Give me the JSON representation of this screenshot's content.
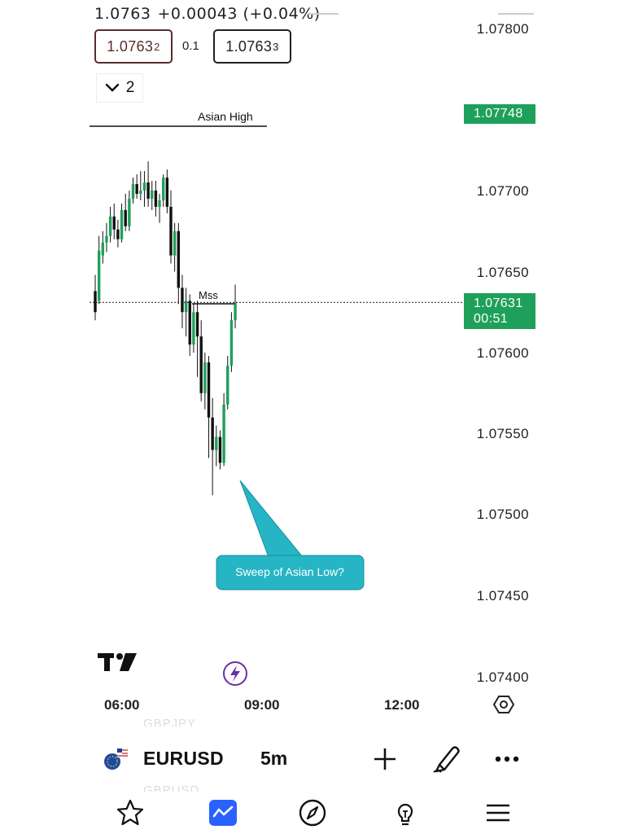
{
  "header": {
    "last_price_partial": "1.0763",
    "change_partial": "+0.00043 (+0.04%)"
  },
  "order": {
    "sell_main": "1.0763",
    "sell_sup": "2",
    "spread": "0.1",
    "buy_main": "1.0763",
    "buy_sup": "3"
  },
  "indicators_toggle": {
    "count": "2"
  },
  "price_axis": {
    "labels": [
      "1.07800",
      "1.07700",
      "1.07650",
      "1.07600",
      "1.07550",
      "1.07500",
      "1.07450",
      "1.07400"
    ],
    "high_tag": "1.07748",
    "last_tag_price": "1.07631",
    "last_tag_timer": "00:51"
  },
  "time_axis": {
    "labels": [
      "06:00",
      "09:00",
      "12:00"
    ]
  },
  "annotations": {
    "asian_high": "Asian High",
    "mss": "Mss",
    "callout": "Sweep of Asian Low?"
  },
  "symbol_bar": {
    "symbol": "EURUSD",
    "interval": "5m"
  },
  "ghost_text": {
    "above": "GBPJPY",
    "below": "GBPUSD"
  },
  "colors": {
    "up": "#1fa05a",
    "down": "#111111",
    "tag": "#1fa05a",
    "callout": "#26b5c4",
    "nav_active": "#2962ff"
  },
  "icons": {
    "collapse": "chevron-down-icon",
    "replay": "lightning-icon",
    "settings": "hexagon-settings-icon",
    "nav": [
      "star-icon",
      "chart-icon",
      "compass-icon",
      "lightbulb-icon",
      "menu-icon"
    ]
  },
  "chart_data": {
    "type": "candlestick",
    "timeframe": "5m",
    "ylim": [
      1.0738,
      1.0781
    ],
    "levels": {
      "asian_high": 1.07748,
      "last": 1.07631,
      "mss": 1.07632
    },
    "candles": [
      {
        "o": 1.07638,
        "h": 1.07648,
        "c": 1.07625,
        "l": 1.0762
      },
      {
        "o": 1.07632,
        "h": 1.07672,
        "c": 1.07663,
        "l": 1.0763
      },
      {
        "o": 1.0766,
        "h": 1.07675,
        "c": 1.07668,
        "l": 1.07655
      },
      {
        "o": 1.07668,
        "h": 1.0768,
        "c": 1.07672,
        "l": 1.07662
      },
      {
        "o": 1.07672,
        "h": 1.0769,
        "c": 1.07684,
        "l": 1.07668
      },
      {
        "o": 1.07684,
        "h": 1.07692,
        "c": 1.07676,
        "l": 1.0767
      },
      {
        "o": 1.07676,
        "h": 1.07682,
        "c": 1.0767,
        "l": 1.07665
      },
      {
        "o": 1.0767,
        "h": 1.07692,
        "c": 1.07688,
        "l": 1.07668
      },
      {
        "o": 1.07688,
        "h": 1.07698,
        "c": 1.07678,
        "l": 1.07675
      },
      {
        "o": 1.07678,
        "h": 1.077,
        "c": 1.07695,
        "l": 1.07675
      },
      {
        "o": 1.07695,
        "h": 1.07708,
        "c": 1.07704,
        "l": 1.07692
      },
      {
        "o": 1.07704,
        "h": 1.0771,
        "c": 1.07698,
        "l": 1.07695
      },
      {
        "o": 1.07698,
        "h": 1.07712,
        "c": 1.077,
        "l": 1.07694
      },
      {
        "o": 1.077,
        "h": 1.07712,
        "c": 1.07705,
        "l": 1.0769
      },
      {
        "o": 1.07705,
        "h": 1.07718,
        "c": 1.07695,
        "l": 1.0769
      },
      {
        "o": 1.07695,
        "h": 1.07706,
        "c": 1.077,
        "l": 1.07688
      },
      {
        "o": 1.077,
        "h": 1.07706,
        "c": 1.0769,
        "l": 1.07684
      },
      {
        "o": 1.0769,
        "h": 1.07698,
        "c": 1.07694,
        "l": 1.0768
      },
      {
        "o": 1.07694,
        "h": 1.0771,
        "c": 1.07708,
        "l": 1.0769
      },
      {
        "o": 1.07708,
        "h": 1.07713,
        "c": 1.0769,
        "l": 1.07686
      },
      {
        "o": 1.0769,
        "h": 1.077,
        "c": 1.0766,
        "l": 1.07655
      },
      {
        "o": 1.0766,
        "h": 1.0768,
        "c": 1.07675,
        "l": 1.0765
      },
      {
        "o": 1.07675,
        "h": 1.0768,
        "c": 1.0764,
        "l": 1.0763
      },
      {
        "o": 1.0764,
        "h": 1.07648,
        "c": 1.07625,
        "l": 1.07615
      },
      {
        "o": 1.07625,
        "h": 1.0764,
        "c": 1.07632,
        "l": 1.0761
      },
      {
        "o": 1.07632,
        "h": 1.07636,
        "c": 1.07605,
        "l": 1.07598
      },
      {
        "o": 1.07605,
        "h": 1.0763,
        "c": 1.07625,
        "l": 1.076
      },
      {
        "o": 1.07625,
        "h": 1.07632,
        "c": 1.0761,
        "l": 1.07585
      },
      {
        "o": 1.0761,
        "h": 1.0762,
        "c": 1.07575,
        "l": 1.0757
      },
      {
        "o": 1.07575,
        "h": 1.076,
        "c": 1.07594,
        "l": 1.07565
      },
      {
        "o": 1.07594,
        "h": 1.07598,
        "c": 1.0756,
        "l": 1.07535
      },
      {
        "o": 1.0756,
        "h": 1.07572,
        "c": 1.0754,
        "l": 1.07512
      },
      {
        "o": 1.0754,
        "h": 1.07555,
        "c": 1.07548,
        "l": 1.0753
      },
      {
        "o": 1.07548,
        "h": 1.07552,
        "c": 1.07532,
        "l": 1.07528
      },
      {
        "o": 1.07532,
        "h": 1.07575,
        "c": 1.07568,
        "l": 1.0753
      },
      {
        "o": 1.07568,
        "h": 1.07598,
        "c": 1.07592,
        "l": 1.07565
      },
      {
        "o": 1.07592,
        "h": 1.07625,
        "c": 1.0762,
        "l": 1.07588
      },
      {
        "o": 1.0762,
        "h": 1.07642,
        "c": 1.07631,
        "l": 1.07615
      }
    ]
  }
}
